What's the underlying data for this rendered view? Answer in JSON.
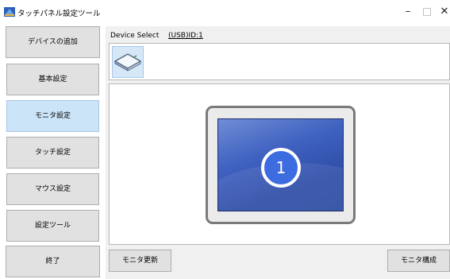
{
  "window": {
    "title": "タッチパネル設定ツール",
    "minimize_glyph": "–",
    "close_glyph": "✕"
  },
  "sidebar": {
    "items": [
      {
        "label": "デバイスの追加",
        "active": false
      },
      {
        "label": "基本設定",
        "active": false
      },
      {
        "label": "モニタ設定",
        "active": true
      },
      {
        "label": "タッチ設定",
        "active": false
      },
      {
        "label": "マウス設定",
        "active": false
      },
      {
        "label": "設定ツール",
        "active": false
      },
      {
        "label": "終了",
        "active": false
      }
    ]
  },
  "device": {
    "label": "Device Select",
    "value": "(USB)ID:1",
    "thumbnail_icon": "touch-panel-icon"
  },
  "monitor": {
    "number": "1",
    "icon": "monitor-icon"
  },
  "buttons": {
    "refresh": "モニタ更新",
    "config": "モニタ構成"
  },
  "colors": {
    "active_item": "#cce4f7",
    "screen_blue": "#3f61c0",
    "button_face": "#e1e1e1"
  }
}
